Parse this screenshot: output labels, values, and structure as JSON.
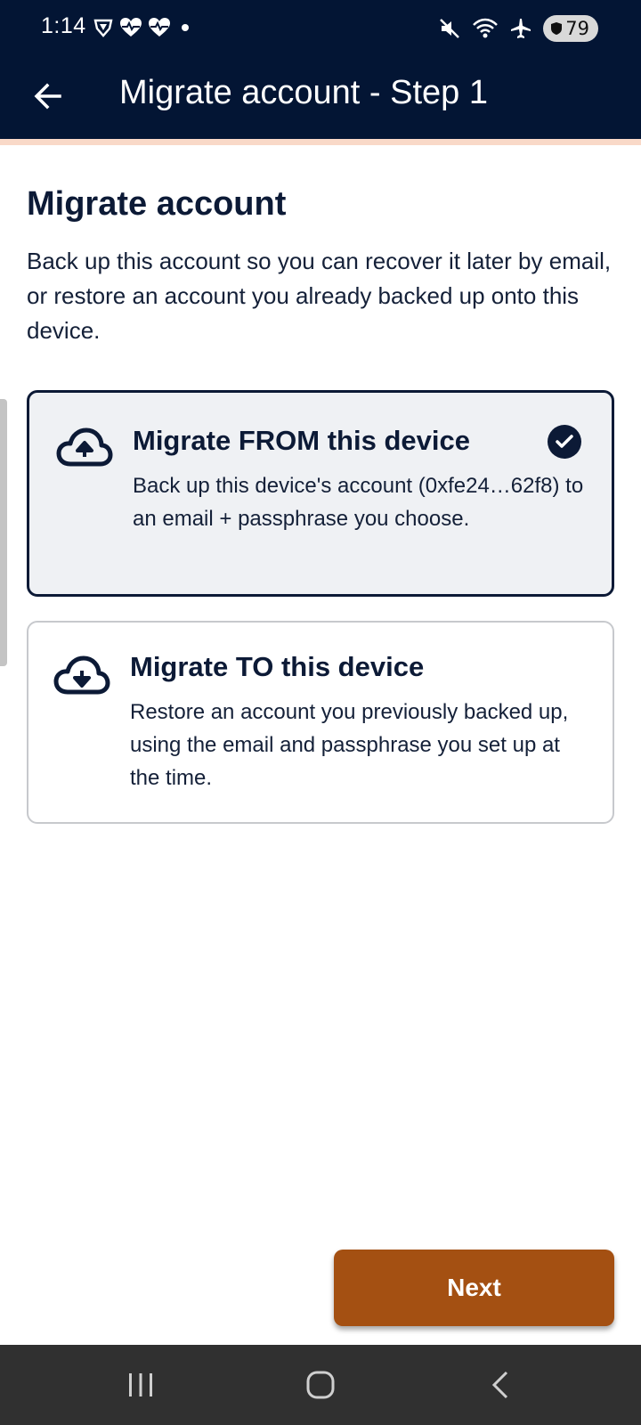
{
  "status_bar": {
    "time": "1:14",
    "battery": "79",
    "left_icons": [
      "vpn-shield-icon",
      "heartbeat-icon",
      "heartbeat-icon",
      "dot-icon"
    ],
    "right_icons": [
      "mute-icon",
      "wifi-icon",
      "airplane-icon",
      "battery-icon"
    ]
  },
  "app_bar": {
    "title": "Migrate account - Step 1",
    "back_icon": "arrow-left-icon",
    "background": "#031534",
    "accent_line": "#f9d9c8"
  },
  "main": {
    "heading": "Migrate account",
    "intro": "Back up this account so you can recover it later by email, or restore an account you already backed up onto this device.",
    "options": [
      {
        "title": "Migrate FROM this device",
        "description": "Back up this device's account (0xfe24…62f8) to an email + passphrase you choose.",
        "icon": "cloud-upload-icon",
        "selected": true
      },
      {
        "title": "Migrate TO this device",
        "description": "Restore an account you previously backed up, using the email and passphrase you set up at the time.",
        "icon": "cloud-download-icon",
        "selected": false
      }
    ]
  },
  "next_button": {
    "label": "Next",
    "color": "#a45012"
  },
  "nav_bar": {
    "items": [
      "recent-apps-icon",
      "home-icon",
      "back-icon"
    ]
  }
}
